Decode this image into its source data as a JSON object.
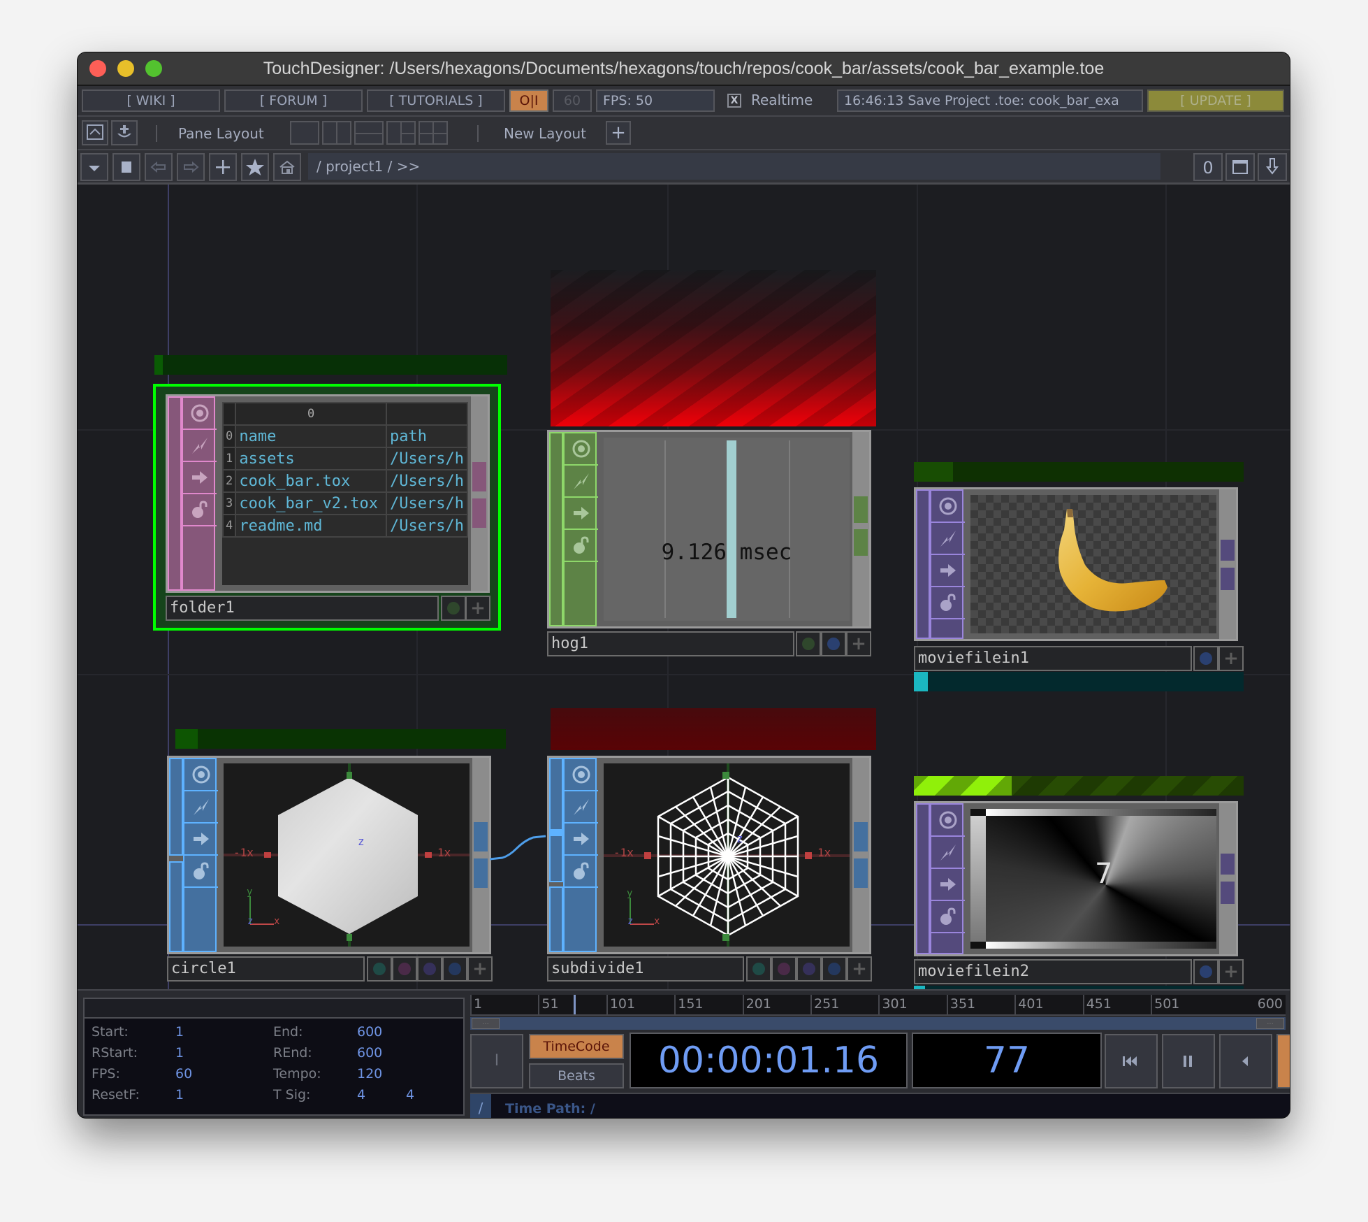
{
  "window": {
    "title": "TouchDesigner: /Users/hexagons/Documents/hexagons/touch/repos/cook_bar/assets/cook_bar_example.toe"
  },
  "toolbar1": {
    "wiki": "[ WIKI ]",
    "forum": "[ FORUM ]",
    "tutorials": "[ TUTORIALS ]",
    "power_toggle": "O|I",
    "fps_target": "60",
    "fps_label": "FPS:  50",
    "realtime_checked": "X",
    "realtime_label": "Realtime",
    "status_message": "16:46:13 Save Project .toe: cook_bar_exa",
    "update": "[ UPDATE ]"
  },
  "toolbar2": {
    "pane_layout_label": "Pane Layout",
    "new_layout_label": "New Layout",
    "add_layout": "+"
  },
  "pathbar": {
    "path": "/ project1 / >>",
    "counter": "0"
  },
  "nodes": {
    "folder1": {
      "name": "folder1",
      "table": {
        "col_header": "0",
        "rows": [
          {
            "idx": "0",
            "name": "name",
            "path": "path"
          },
          {
            "idx": "1",
            "name": "assets",
            "path": "/Users/h"
          },
          {
            "idx": "2",
            "name": "cook_bar.tox",
            "path": "/Users/h"
          },
          {
            "idx": "3",
            "name": "cook_bar_v2.tox",
            "path": "/Users/h"
          },
          {
            "idx": "4",
            "name": "readme.md",
            "path": "/Users/h"
          }
        ]
      }
    },
    "hog1": {
      "name": "hog1",
      "readout": "9.126 msec"
    },
    "moviefilein1": {
      "name": "moviefilein1"
    },
    "circle1": {
      "name": "circle1",
      "axis_neg": "-1x",
      "axis_pos": "1x",
      "axis_z": "z",
      "gizmo_x": "x",
      "gizmo_y": "y",
      "gizmo_z": "z"
    },
    "subdivide1": {
      "name": "subdivide1",
      "axis_neg": "-1x",
      "axis_pos": "1x",
      "axis_z": "z",
      "gizmo_x": "x",
      "gizmo_y": "y",
      "gizmo_z": "z"
    },
    "moviefilein2": {
      "name": "moviefilein2",
      "overlay_digit": "7"
    }
  },
  "timeline": {
    "info": {
      "start_label": "Start:",
      "start": "1",
      "end_label": "End:",
      "end": "600",
      "rstart_label": "RStart:",
      "rstart": "1",
      "rend_label": "REnd:",
      "rend": "600",
      "fps_label": "FPS:",
      "fps": "60",
      "tempo_label": "Tempo:",
      "tempo": "120",
      "resetf_label": "ResetF:",
      "resetf": "1",
      "tsig_label": "T Sig:",
      "tsig_num": "4",
      "tsig_den": "4"
    },
    "ruler_ticks": [
      "1",
      "51",
      "101",
      "151",
      "201",
      "251",
      "301",
      "351",
      "401",
      "451",
      "501",
      "600"
    ],
    "scroll_thumb": "...",
    "range_in_button": "I",
    "timecode_button": "TimeCode",
    "beats_button": "Beats",
    "timecode": "00:00:01.16",
    "frame": "77",
    "time_path_slash": "/",
    "time_path": "Time Path: /",
    "playhead_frame": 77
  },
  "colors": {
    "selected_outline": "#00ff00",
    "dat_color": "#86577a",
    "chop_color": "#5d8346",
    "top_color": "#544a7c",
    "sop_color": "#44709f",
    "timecode_active": "#c9834b",
    "update_button": "#8c8a3a"
  }
}
